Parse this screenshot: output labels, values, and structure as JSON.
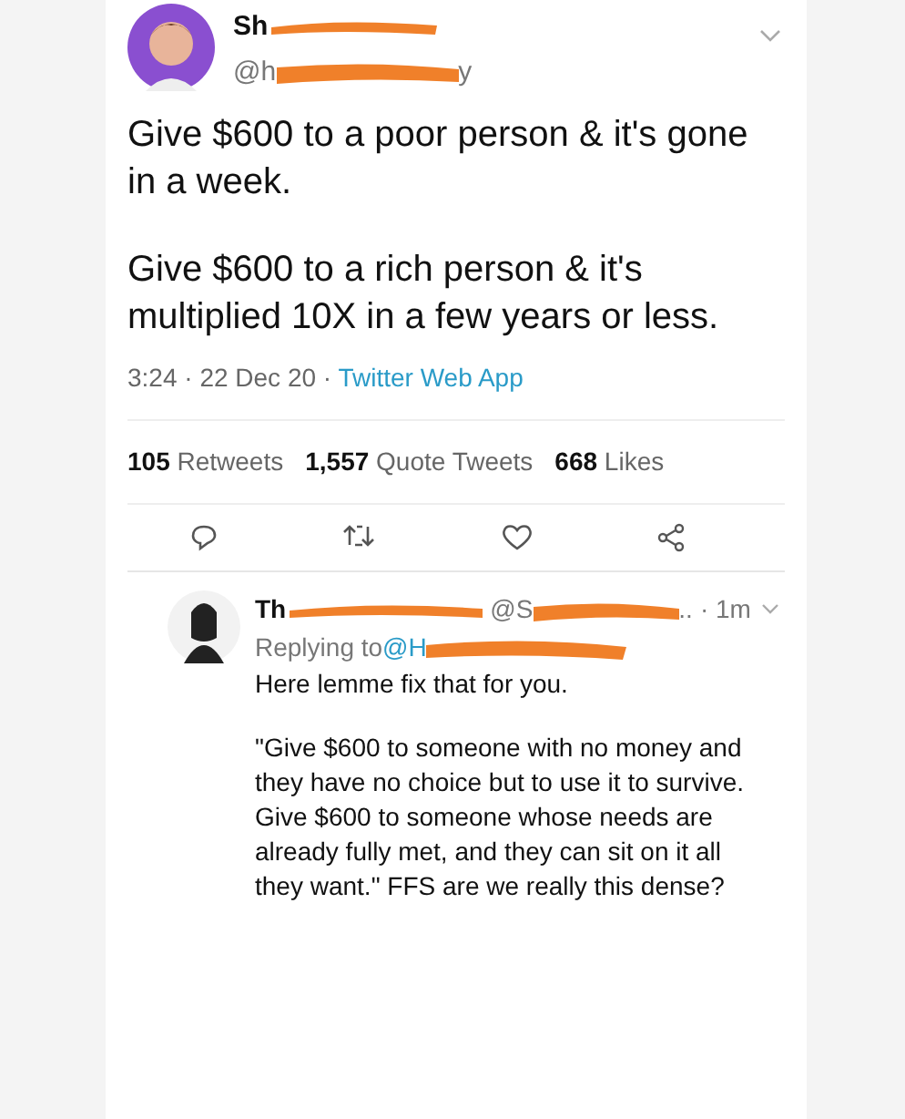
{
  "tweet": {
    "name_visible": "Sh",
    "handle_start": "@h",
    "handle_end": "y",
    "paragraphs": [
      "Give $600 to a poor person & it's gone in a week.",
      "Give $600 to a rich person & it's multiplied 10X in a few years or less."
    ],
    "time": "3:24 · 22 Dec 20 · ",
    "source": "Twitter Web App",
    "stats": [
      {
        "count": "105",
        "label": "Retweets"
      },
      {
        "count": "1,557",
        "label": "Quote Tweets"
      },
      {
        "count": "668",
        "label": "Likes"
      }
    ]
  },
  "reply": {
    "name_visible": "Th",
    "handle_start": "@S",
    "handle_end": "..",
    "time": "· 1m",
    "replying_label": "Replying to ",
    "replying_handle": "@H",
    "paragraphs": [
      "Here lemme fix that for you.",
      "\"Give $600 to someone with no money and they have no choice but to use it to survive. Give $600 to someone whose needs are already fully met, and they can sit on it all they want.\" FFS are we really this dense?"
    ]
  }
}
